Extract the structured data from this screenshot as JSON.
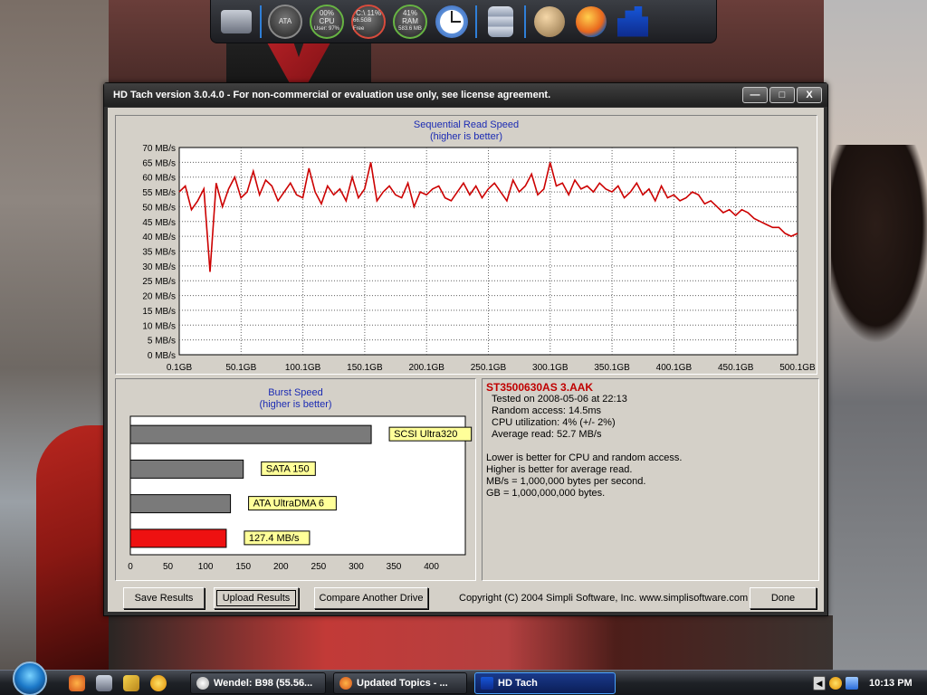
{
  "window": {
    "title": "HD Tach version 3.0.4.0  - For non-commercial or evaluation use only, see license agreement.",
    "minimize": "—",
    "maximize": "□",
    "close": "X"
  },
  "gadgets": {
    "cpu_pct": "00%",
    "cpu_label": "CPU",
    "cpu_sub": "User: 97%",
    "disk_pct": "C:\\ 11%",
    "disk_sub": "66.5GB Free",
    "ram_pct": "41%",
    "ram_label": "RAM",
    "ram_sub": "583.6 MB",
    "gpu_label": "ATA"
  },
  "seq_chart": {
    "title": "Sequential Read Speed",
    "subtitle": "(higher is better)",
    "y_ticks": [
      "70 MB/s",
      "65 MB/s",
      "60 MB/s",
      "55 MB/s",
      "50 MB/s",
      "45 MB/s",
      "40 MB/s",
      "35 MB/s",
      "30 MB/s",
      "25 MB/s",
      "20 MB/s",
      "15 MB/s",
      "10 MB/s",
      "5 MB/s",
      "0 MB/s"
    ],
    "x_ticks": [
      "0.1GB",
      "50.1GB",
      "100.1GB",
      "150.1GB",
      "200.1GB",
      "250.1GB",
      "300.1GB",
      "350.1GB",
      "400.1GB",
      "450.1GB",
      "500.1GB"
    ]
  },
  "burst_chart": {
    "title": "Burst Speed",
    "subtitle": "(higher is better)",
    "x_ticks": [
      "0",
      "50",
      "100",
      "150",
      "200",
      "250",
      "300",
      "350",
      "400"
    ]
  },
  "chart_data": [
    {
      "type": "line",
      "title": "Sequential Read Speed",
      "subtitle": "(higher is better)",
      "xlabel": "",
      "ylabel": "",
      "x_unit": "GB",
      "y_unit": "MB/s",
      "xlim": [
        0.1,
        500.1
      ],
      "ylim": [
        0,
        70
      ],
      "grid": true,
      "line_color": "#cc0000",
      "series": [
        {
          "x": [
            0.1,
            5,
            10,
            15,
            20,
            25,
            30,
            35,
            40,
            45,
            50,
            55,
            60,
            65,
            70,
            75,
            80,
            85,
            90,
            95,
            100,
            105,
            110,
            115,
            120,
            125,
            130,
            135,
            140,
            145,
            150,
            155,
            160,
            165,
            170,
            175,
            180,
            185,
            190,
            195,
            200,
            205,
            210,
            215,
            220,
            225,
            230,
            235,
            240,
            245,
            250,
            255,
            260,
            265,
            270,
            275,
            280,
            285,
            290,
            295,
            300,
            305,
            310,
            315,
            320,
            325,
            330,
            335,
            340,
            345,
            350,
            355,
            360,
            365,
            370,
            375,
            380,
            385,
            390,
            395,
            400,
            405,
            410,
            415,
            420,
            425,
            430,
            435,
            440,
            445,
            450,
            455,
            460,
            465,
            470,
            475,
            480,
            485,
            490,
            495,
            500.1
          ],
          "y": [
            55,
            57,
            49,
            52,
            56,
            28,
            58,
            50,
            56,
            60,
            53,
            55,
            62,
            54,
            59,
            57,
            52,
            55,
            58,
            54,
            53,
            63,
            55,
            51,
            57,
            54,
            56,
            52,
            60,
            53,
            56,
            65,
            52,
            55,
            57,
            54,
            53,
            58,
            50,
            55,
            54,
            56,
            57,
            53,
            52,
            55,
            58,
            54,
            57,
            53,
            56,
            58,
            55,
            52,
            59,
            55,
            57,
            61,
            54,
            56,
            65,
            57,
            58,
            54,
            59,
            56,
            57,
            55,
            58,
            56,
            55,
            57,
            53,
            55,
            58,
            54,
            56,
            52,
            57,
            53,
            54,
            52,
            53,
            55,
            54,
            51,
            52,
            50,
            48,
            49,
            47,
            49,
            48,
            46,
            45,
            44,
            43,
            43,
            41,
            40,
            41
          ]
        }
      ]
    },
    {
      "type": "bar",
      "title": "Burst Speed",
      "subtitle": "(higher is better)",
      "orientation": "horizontal",
      "xlim": [
        0,
        445
      ],
      "categories": [
        "SCSI Ultra320",
        "SATA 150",
        "ATA UltraDMA 6",
        "127.4 MB/s"
      ],
      "values": [
        320,
        150,
        133,
        127.4
      ],
      "colors": [
        "#7a7a7a",
        "#7a7a7a",
        "#7a7a7a",
        "#ee1111"
      ]
    }
  ],
  "info": {
    "drive": "ST3500630AS  3.AAK",
    "tested": "Tested on 2008-05-06 at 22:13",
    "random_access": "Random access: 14.5ms",
    "cpu_util": "CPU utilization: 4% (+/- 2%)",
    "avg_read": "Average read: 52.7 MB/s",
    "note1": "Lower is better for CPU and random access.",
    "note2": "Higher is better for average read.",
    "note3": "MB/s = 1,000,000 bytes per second.",
    "note4": "GB = 1,000,000,000 bytes."
  },
  "buttons": {
    "save": "Save Results",
    "upload": "Upload Results",
    "compare": "Compare Another Drive",
    "done": "Done"
  },
  "copyright": "Copyright (C) 2004 Simpli Software, Inc. www.simplisoftware.com",
  "taskbar": {
    "tasks": [
      {
        "label": "Wendel:  B98 (55.56...",
        "active": false
      },
      {
        "label": "Updated Topics - ...",
        "active": false
      },
      {
        "label": "HD Tach",
        "active": true
      }
    ],
    "tray_arrow": "◀",
    "clock": "10:13 PM"
  },
  "colors": {
    "chart_bg": "#ffffff",
    "line": "#cc0000",
    "title_blue": "#1b2bb3",
    "bar_gray": "#7a7a7a",
    "bar_red": "#ee1111",
    "label_yellow": "#ffff99",
    "dialog": "#d4d0c8"
  }
}
